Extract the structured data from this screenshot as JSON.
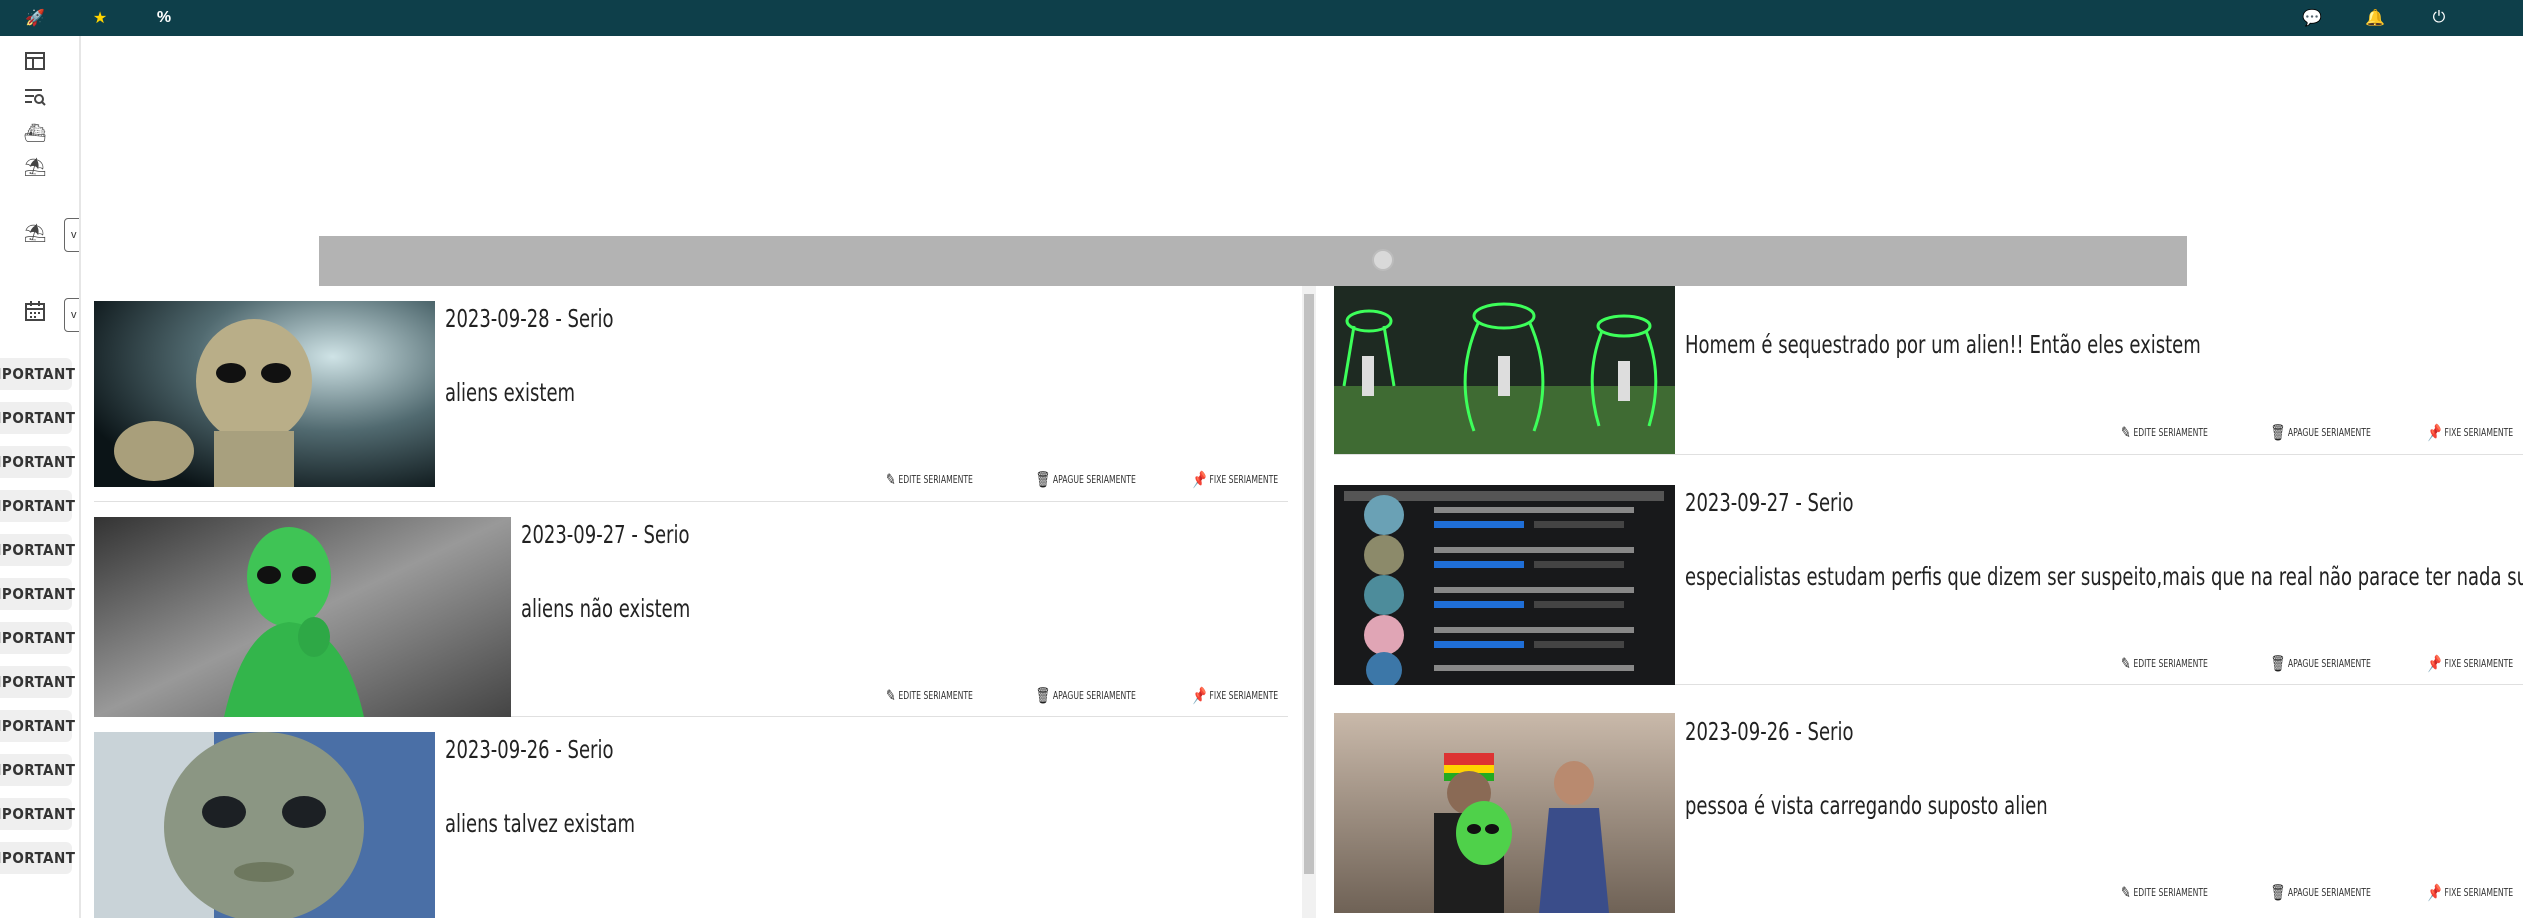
{
  "topbar": {
    "left_icons": [
      "rocket-icon",
      "star-icon",
      "percent-icon"
    ],
    "right_icons": [
      "chat-icon",
      "bell-icon",
      "power-icon"
    ]
  },
  "sidebar": {
    "icons": [
      "dashboard-icon",
      "filter-search-icon",
      "ship-icon",
      "beach-icon"
    ],
    "select_one_value": "v",
    "select_two_value": "v",
    "tags": [
      "MPORTANT",
      "MPORTANT",
      "MPORTANT",
      "MPORTANT",
      "MPORTANT",
      "MPORTANT",
      "MPORTANT",
      "MPORTANT",
      "MPORTANT",
      "MPORTANT",
      "MPORTANT",
      "MPORTANT"
    ]
  },
  "actions": {
    "edit": "EDITE SERIAMENTE",
    "delete": "APAGUE SERIAMENTE",
    "pin": "FIXE SERIAMENTE"
  },
  "left_posts": [
    {
      "title": "2023-09-28 - Serio",
      "description": "aliens existem"
    },
    {
      "title": "2023-09-27 - Serio",
      "description": "aliens não existem"
    },
    {
      "title": "2023-09-26 - Serio",
      "description": "aliens talvez existam"
    }
  ],
  "right_posts": [
    {
      "title": "",
      "description": "Homem é sequestrado por um alien!! Então eles existem"
    },
    {
      "title": "2023-09-27 - Serio",
      "description": "especialistas estudam perfis que dizem ser suspeito,mais que na real não parace ter nada suspeito"
    },
    {
      "title": "2023-09-26 - Serio",
      "description": "pessoa é vista carregando suposto alien"
    }
  ],
  "colors": {
    "topbar": "#0e3f4a",
    "star": "#ffd400",
    "bell": "#ffd400",
    "banner": "#b3b3b3"
  }
}
